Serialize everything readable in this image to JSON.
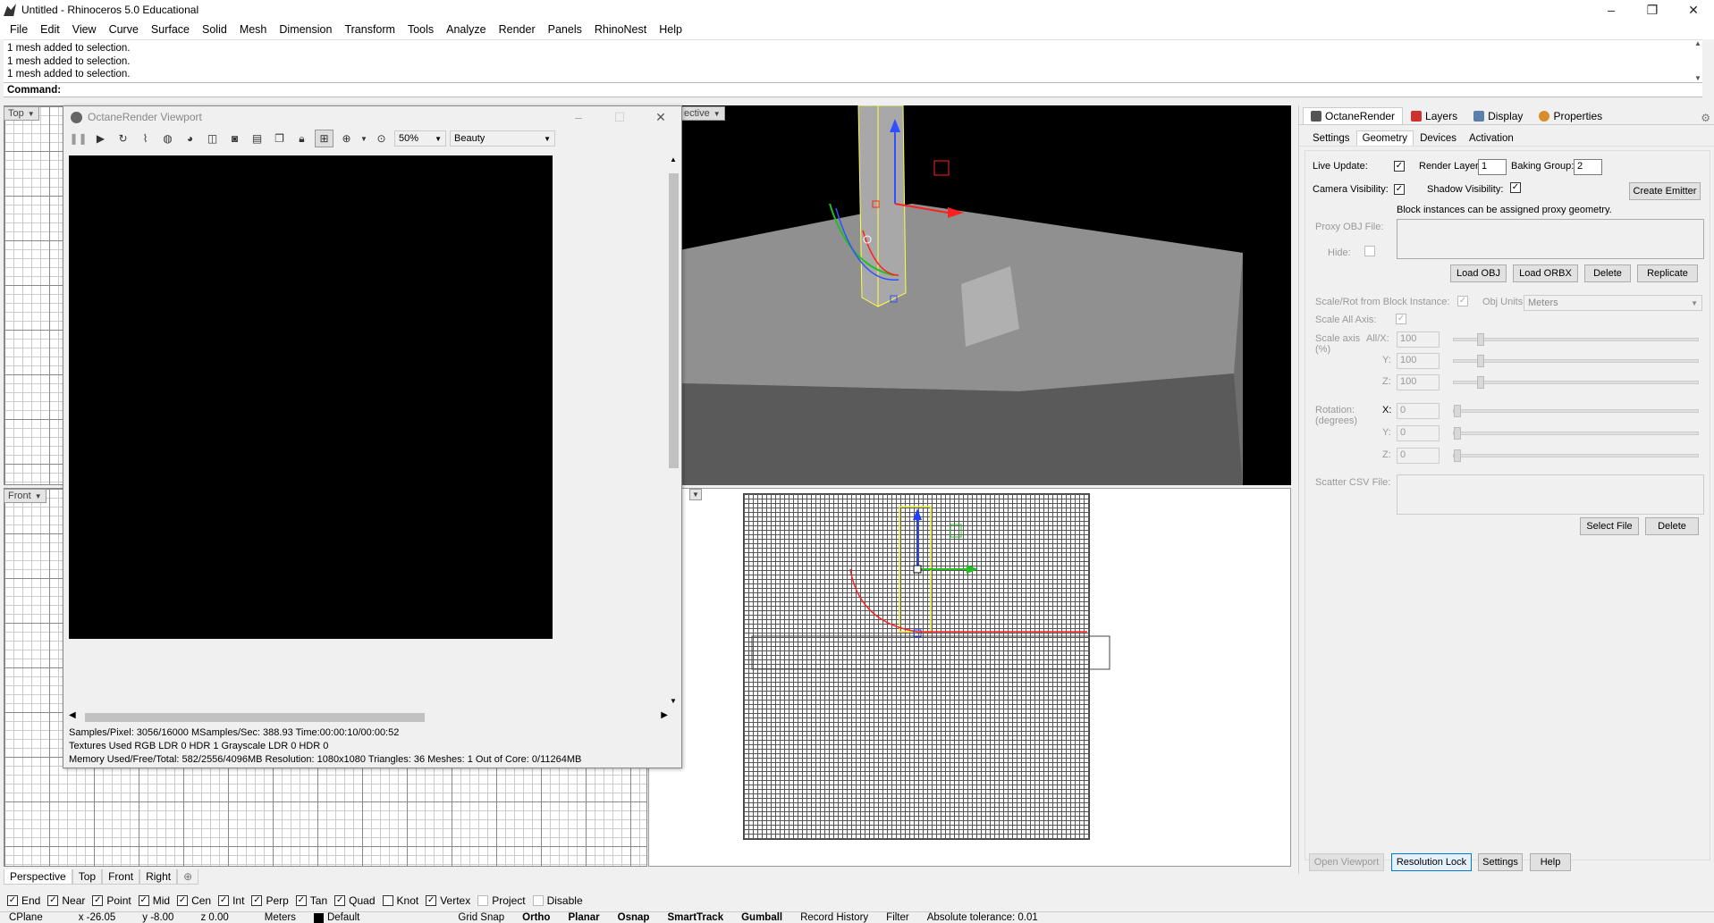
{
  "window": {
    "title": "Untitled - Rhinoceros 5.0 Educational",
    "minimize": "–",
    "maximize": "❐",
    "close": "✕"
  },
  "menu": [
    "File",
    "Edit",
    "View",
    "Curve",
    "Surface",
    "Solid",
    "Mesh",
    "Dimension",
    "Transform",
    "Tools",
    "Analyze",
    "Render",
    "Panels",
    "RhinoNest",
    "Help"
  ],
  "history": [
    "1 mesh added to selection.",
    "1 mesh added to selection.",
    "1 mesh added to selection."
  ],
  "command": {
    "label": "Command:",
    "value": ""
  },
  "viewports": {
    "top": "Top",
    "front": "Front",
    "perspective": "ective"
  },
  "octane": {
    "title": "OctaneRender Viewport",
    "zoom": "50%",
    "mode": "Beauty",
    "status": [
      "Samples/Pixel: 3056/16000  MSamples/Sec: 388.93  Time:00:00:10/00:00:52",
      "Textures Used RGB LDR 0   HDR 1  Grayscale LDR 0   HDR 0",
      "Memory Used/Free/Total: 582/2556/4096MB  Resolution: 1080x1080  Triangles: 36  Meshes: 1 Out of Core: 0/11264MB"
    ]
  },
  "panel": {
    "tabs": [
      {
        "label": "OctaneRender",
        "color": "#555555"
      },
      {
        "label": "Layers",
        "color": "#cc3333"
      },
      {
        "label": "Display",
        "color": "#5a7fa8"
      },
      {
        "label": "Properties",
        "color": "#d98c2b"
      }
    ],
    "subtabs": [
      "Settings",
      "Geometry",
      "Devices",
      "Activation"
    ],
    "live_update": "Live Update:",
    "render_layer": "Render Layer:",
    "render_layer_value": "1",
    "baking_group": "Baking Group:",
    "baking_group_value": "2",
    "camera_visibility": "Camera Visibility:",
    "shadow_visibility": "Shadow Visibility:",
    "create_emitter": "Create Emitter",
    "block_note": "Block instances can be assigned proxy geometry.",
    "proxy_obj": "Proxy OBJ File:",
    "hide": "Hide:",
    "load_obj": "Load OBJ",
    "load_orbx": "Load ORBX",
    "delete": "Delete",
    "replicate": "Replicate",
    "scale_rot": "Scale/Rot from Block Instance:",
    "obj_units": "Obj Units:",
    "obj_units_value": "Meters",
    "scale_all_axis": "Scale All Axis:",
    "scale_axis": "Scale axis",
    "scale_pct": "(%)",
    "all_x": "All/X:",
    "y": "Y:",
    "z": "Z:",
    "x": "X:",
    "scale_values": [
      "100",
      "100",
      "100"
    ],
    "rotation": "Rotation:",
    "degrees": "(degrees)",
    "rotation_values": [
      "0",
      "0",
      "0"
    ],
    "scatter_csv": "Scatter CSV File:",
    "select_file": "Select File",
    "delete2": "Delete",
    "open_viewport": "Open Viewport",
    "resolution_lock": "Resolution Lock",
    "settings": "Settings",
    "help": "Help"
  },
  "viewport_tabs": [
    "Perspective",
    "Top",
    "Front",
    "Right"
  ],
  "osnaps": [
    {
      "label": "End",
      "checked": true
    },
    {
      "label": "Near",
      "checked": true
    },
    {
      "label": "Point",
      "checked": true
    },
    {
      "label": "Mid",
      "checked": true
    },
    {
      "label": "Cen",
      "checked": true
    },
    {
      "label": "Int",
      "checked": true
    },
    {
      "label": "Perp",
      "checked": true
    },
    {
      "label": "Tan",
      "checked": true
    },
    {
      "label": "Quad",
      "checked": true
    },
    {
      "label": "Knot",
      "checked": false
    },
    {
      "label": "Vertex",
      "checked": true
    },
    {
      "label": "Project",
      "checked": false
    },
    {
      "label": "Disable",
      "checked": false
    }
  ],
  "statusbar": {
    "cplane": "CPlane",
    "x": "x -26.05",
    "y": "y -8.00",
    "z": "z 0.00",
    "units": "Meters",
    "layer": "Default",
    "grid_snap": "Grid Snap",
    "ortho": "Ortho",
    "planar": "Planar",
    "osnap": "Osnap",
    "smarttrack": "SmartTrack",
    "gumball": "Gumball",
    "record_history": "Record History",
    "filter": "Filter",
    "tolerance": "Absolute tolerance: 0.01"
  },
  "colors": {
    "accent": "#0078d7",
    "gumball_x": "#ff2020",
    "gumball_y": "#20c020",
    "gumball_z": "#2040ff",
    "selection": "#e8e840"
  }
}
